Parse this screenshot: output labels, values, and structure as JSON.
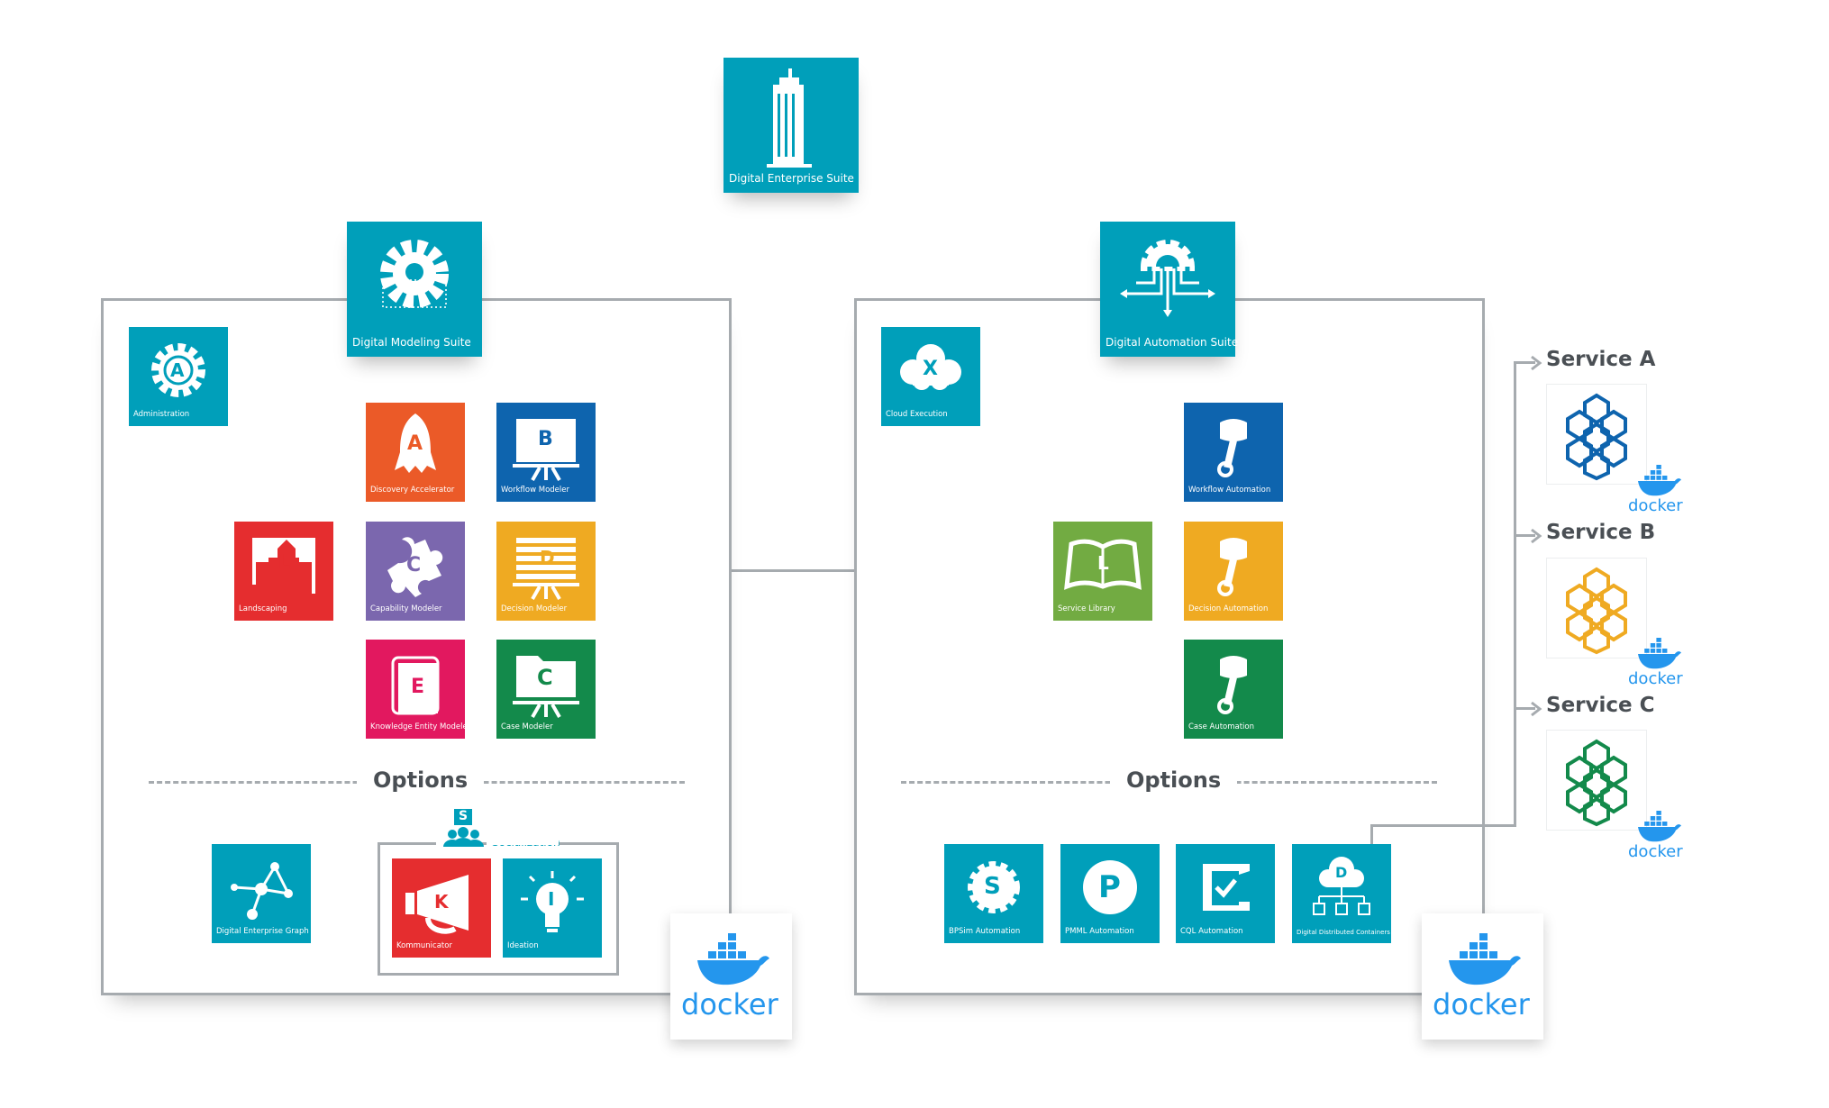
{
  "colors": {
    "teal": "#009fba",
    "orange": "#eb5a28",
    "blue": "#0e64ae",
    "red": "#e52d2f",
    "purple": "#7b67ae",
    "yellow": "#efaa22",
    "pink": "#e2185f",
    "green": "#138a4b",
    "lime": "#72ab42",
    "docker": "#2496ed",
    "line": "#a6abaf"
  },
  "top": {
    "label": "Digital Enterprise Suite",
    "icon": "skyscraper-icon"
  },
  "modeling": {
    "suite": {
      "label": "Digital Modeling Suite",
      "icon": "gear-dots-icon"
    },
    "admin": {
      "label": "Administration",
      "letter": "A",
      "icon": "gear-icon"
    },
    "tiles": [
      {
        "label": "Discovery Accelerator",
        "letter": "A",
        "icon": "rocket-icon"
      },
      {
        "label": "Workflow  Modeler",
        "letter": "B",
        "icon": "easel-icon"
      },
      {
        "label": "Landscaping",
        "letter": "L",
        "icon": "city-icon"
      },
      {
        "label": "Capability Modeler",
        "letter": "C",
        "icon": "puzzle-icon"
      },
      {
        "label": "Decision Modeler",
        "letter": "D",
        "icon": "table-easel-icon"
      },
      {
        "label": "Knowledge Entity Modeler",
        "letter": "E",
        "icon": "book-icon"
      },
      {
        "label": "Case Modeler",
        "letter": "C",
        "icon": "folder-easel-icon"
      }
    ],
    "options_label": "Options",
    "graph": {
      "label": "Digital Enterprise Graph",
      "icon": "network-icon"
    },
    "socialization": {
      "label": "Socialization",
      "letter": "S",
      "icon": "people-icon"
    },
    "kommunicator": {
      "label": "Kommunicator",
      "letter": "K",
      "icon": "megaphone-icon"
    },
    "ideation": {
      "label": "Ideation",
      "letter": "I",
      "icon": "lightbulb-icon"
    },
    "docker": "docker"
  },
  "automation": {
    "suite": {
      "label": "Digital Automation Suite",
      "icon": "gear-arrows-icon"
    },
    "cloud": {
      "label": "Cloud Execution",
      "letter": "X",
      "icon": "cloud-icon"
    },
    "tiles": [
      {
        "label": "Workflow Automation",
        "icon": "piston-icon"
      },
      {
        "label": "Service Library",
        "letter": "L",
        "icon": "open-book-icon"
      },
      {
        "label": "Decision Automation",
        "icon": "piston-icon"
      },
      {
        "label": "Case Automation",
        "icon": "piston-icon"
      }
    ],
    "options_label": "Options",
    "options": [
      {
        "label": "BPSim Automation",
        "letter": "S",
        "icon": "gear-s-icon"
      },
      {
        "label": "PMML Automation",
        "letter": "P",
        "icon": "p-circle-icon"
      },
      {
        "label": "CQL Automation",
        "icon": "c-check-icon"
      },
      {
        "label": "Digital Distributed Containers",
        "letter": "D",
        "icon": "cloud-tree-icon"
      }
    ],
    "docker": "docker"
  },
  "services": [
    {
      "label": "Service A",
      "color": "#0e64ae",
      "docker": "docker"
    },
    {
      "label": "Service B",
      "color": "#efaa22",
      "docker": "docker"
    },
    {
      "label": "Service C",
      "color": "#138a4b",
      "docker": "docker"
    }
  ]
}
